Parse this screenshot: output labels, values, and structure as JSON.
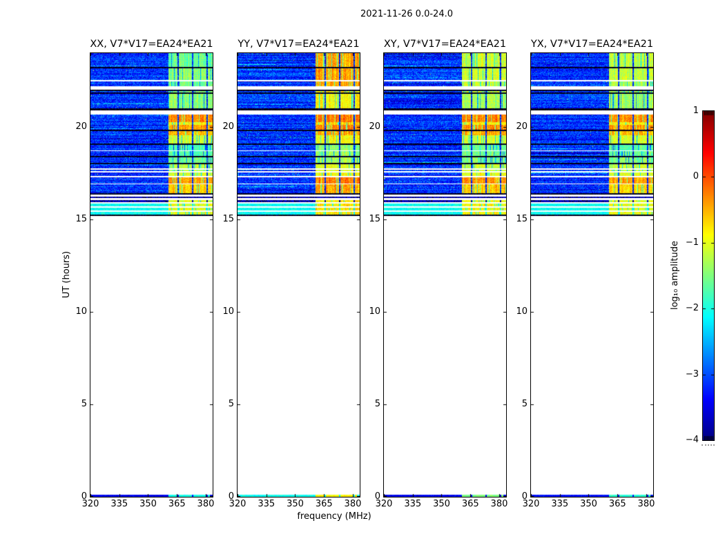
{
  "chart_data": {
    "type": "heatmap",
    "suptitle": "2021-11-26 0.0-24.0",
    "xlabel": "frequency (MHz)",
    "ylabel": "UT (hours)",
    "x_range": [
      320,
      383.6
    ],
    "x_ticks": [
      320,
      335,
      350,
      365,
      380
    ],
    "x_tick_labels": [
      "320",
      "335",
      "350",
      "365",
      "380"
    ],
    "y_range": [
      0,
      24
    ],
    "y_ticks": [
      0,
      5,
      10,
      15,
      20
    ],
    "y_tick_labels": [
      "0",
      "5",
      "10",
      "15",
      "20"
    ],
    "grid": false,
    "colorbar": {
      "label": "log₁₀ amplitude",
      "colormap": "jet",
      "vmin": -4,
      "vmax": 1,
      "ticks": [
        1,
        0,
        -1,
        -2,
        -3,
        -4
      ],
      "tick_labels": [
        "1",
        "0",
        "−1",
        "−2",
        "−3",
        "−4"
      ]
    },
    "panels": [
      {
        "id": "xx",
        "title": "XX, V7*V17=EA24*EA21"
      },
      {
        "id": "yy",
        "title": "YY, V7*V17=EA24*EA21"
      },
      {
        "id": "xy",
        "title": "XY, V7*V17=EA24*EA21"
      },
      {
        "id": "yx",
        "title": "YX, V7*V17=EA24*EA21"
      }
    ],
    "observed_span_ut": [
      15.19,
      24.0
    ],
    "rfi_band": {
      "start_mhz": 360.5,
      "end_mhz": 383.6,
      "dividers_mhz": [
        365.3,
        372.8,
        380.2
      ]
    },
    "background_level": -3.6,
    "segments": [
      {
        "ut": [
          24.0,
          23.26
        ],
        "kind": "noise",
        "band": [
          -1.6,
          -0.45,
          -1.15,
          -1.25
        ]
      },
      {
        "ut": [
          23.26,
          23.19
        ],
        "kind": "line"
      },
      {
        "ut": [
          23.19,
          22.55
        ],
        "kind": "noise",
        "band": [
          -1.45,
          -0.4,
          -1.1,
          -1.2
        ]
      },
      {
        "ut": [
          22.55,
          22.47
        ],
        "kind": "white"
      },
      {
        "ut": [
          22.47,
          22.21
        ],
        "kind": "noise",
        "band": [
          -1.6,
          -0.5,
          -1.2,
          -1.3
        ]
      },
      {
        "ut": [
          22.21,
          22.02
        ],
        "kind": "white"
      },
      {
        "ut": [
          22.02,
          21.95
        ],
        "kind": "line"
      },
      {
        "ut": [
          21.95,
          21.88
        ],
        "kind": "noise",
        "band": [
          -1.5,
          -0.8,
          -1.2,
          -1.3
        ]
      },
      {
        "ut": [
          21.88,
          21.81
        ],
        "kind": "line"
      },
      {
        "ut": [
          21.81,
          21.0
        ],
        "kind": "noise",
        "band": [
          -1.45,
          -0.85,
          -1.3,
          -1.35
        ]
      },
      {
        "ut": [
          21.0,
          20.91
        ],
        "kind": "line"
      },
      {
        "ut": [
          20.91,
          20.66
        ],
        "kind": "white"
      },
      {
        "ut": [
          20.66,
          20.27
        ],
        "kind": "noise",
        "band": [
          -0.35,
          -0.22,
          -0.3,
          -0.35
        ]
      },
      {
        "ut": [
          20.27,
          20.12
        ],
        "kind": "noise",
        "band": [
          -0.95,
          -0.7,
          -0.85,
          -0.9
        ]
      },
      {
        "ut": [
          20.12,
          19.86
        ],
        "kind": "noise",
        "band": [
          -0.4,
          -0.3,
          -0.35,
          -0.4
        ]
      },
      {
        "ut": [
          19.86,
          19.78
        ],
        "kind": "line"
      },
      {
        "ut": [
          19.78,
          19.56
        ],
        "kind": "noise",
        "band": [
          -0.55,
          -0.45,
          -0.5,
          -0.6
        ]
      },
      {
        "ut": [
          19.56,
          19.11
        ],
        "kind": "noise",
        "band": [
          -1.15,
          -0.9,
          -1.05,
          -1.1
        ]
      },
      {
        "ut": [
          19.11,
          19.04
        ],
        "kind": "line"
      },
      {
        "ut": [
          19.04,
          18.74
        ],
        "kind": "noise",
        "band": [
          -1.75,
          -1.45,
          -1.6,
          -1.65
        ]
      },
      {
        "ut": [
          18.74,
          18.7
        ],
        "kind": "white"
      },
      {
        "ut": [
          18.7,
          18.44
        ],
        "kind": "noise",
        "band": [
          -1.7,
          -1.4,
          -1.6,
          -1.6
        ]
      },
      {
        "ut": [
          18.44,
          18.37
        ],
        "kind": "line"
      },
      {
        "ut": [
          18.37,
          18.07
        ],
        "kind": "noise",
        "band": [
          -1.55,
          -1.3,
          -1.5,
          -1.5
        ]
      },
      {
        "ut": [
          18.07,
          17.99
        ],
        "kind": "line"
      },
      {
        "ut": [
          17.99,
          17.77
        ],
        "kind": "noise",
        "band": [
          -1.25,
          -1.0,
          -1.15,
          -1.2
        ]
      },
      {
        "ut": [
          17.77,
          17.69
        ],
        "kind": "white"
      },
      {
        "ut": [
          17.69,
          17.62
        ],
        "kind": "noise",
        "band": [
          -1.2,
          -1.0,
          -1.1,
          -1.2
        ]
      },
      {
        "ut": [
          17.62,
          17.54
        ],
        "kind": "white"
      },
      {
        "ut": [
          17.54,
          17.36
        ],
        "kind": "noise",
        "band": [
          -1.05,
          -0.85,
          -0.95,
          -1.05
        ]
      },
      {
        "ut": [
          17.36,
          17.28
        ],
        "kind": "white"
      },
      {
        "ut": [
          17.28,
          16.95
        ],
        "kind": "noise",
        "band": [
          -0.4,
          -0.28,
          -0.35,
          -0.4
        ]
      },
      {
        "ut": [
          16.95,
          16.91
        ],
        "kind": "white"
      },
      {
        "ut": [
          16.91,
          16.42
        ],
        "kind": "noise",
        "band": [
          -0.65,
          -0.5,
          -0.6,
          -0.7
        ]
      },
      {
        "ut": [
          16.42,
          16.35
        ],
        "kind": "line"
      },
      {
        "ut": [
          16.35,
          16.24
        ],
        "kind": "white"
      },
      {
        "ut": [
          16.24,
          16.16
        ],
        "kind": "dark"
      },
      {
        "ut": [
          16.16,
          16.05
        ],
        "kind": "white"
      },
      {
        "ut": [
          16.05,
          15.94
        ],
        "kind": "dark",
        "band": [
          -1.0,
          -0.8,
          -0.9,
          -1.0
        ]
      },
      {
        "ut": [
          15.94,
          15.86
        ],
        "kind": "white"
      },
      {
        "ut": [
          15.86,
          15.71
        ],
        "kind": "stripe",
        "band": [
          -1.0,
          -0.75,
          -0.9,
          -1.0
        ]
      },
      {
        "ut": [
          15.71,
          15.64
        ],
        "kind": "white"
      },
      {
        "ut": [
          15.64,
          15.49
        ],
        "kind": "stripe",
        "band": [
          -1.0,
          -0.75,
          -0.9,
          -1.0
        ]
      },
      {
        "ut": [
          15.49,
          15.42
        ],
        "kind": "white"
      },
      {
        "ut": [
          15.42,
          15.27
        ],
        "kind": "stripe",
        "band": [
          -1.0,
          -0.75,
          -0.9,
          -1.0
        ]
      },
      {
        "ut": [
          15.27,
          15.19
        ],
        "kind": "line"
      },
      {
        "ut": [
          0.11,
          0.0
        ],
        "kind": "strip",
        "bg": [
          -3.7,
          -2.3,
          -3.7,
          -3.6
        ],
        "band": [
          -2.0,
          -0.85,
          -1.5,
          -1.9
        ]
      }
    ]
  }
}
